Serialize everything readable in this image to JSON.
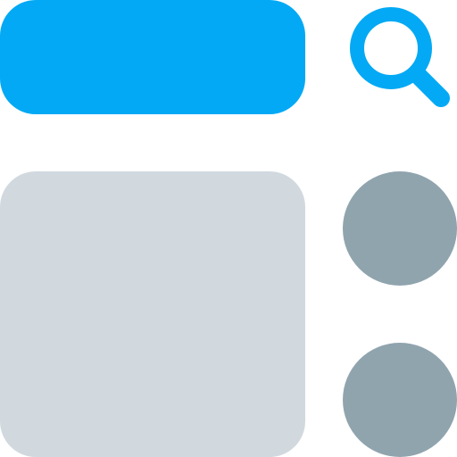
{
  "colors": {
    "accent": "#03A9F4",
    "panel": "#D1D9DF",
    "dot": "#90A4AE",
    "background": "#FFFFFF"
  },
  "icons": {
    "search": "search-icon"
  }
}
